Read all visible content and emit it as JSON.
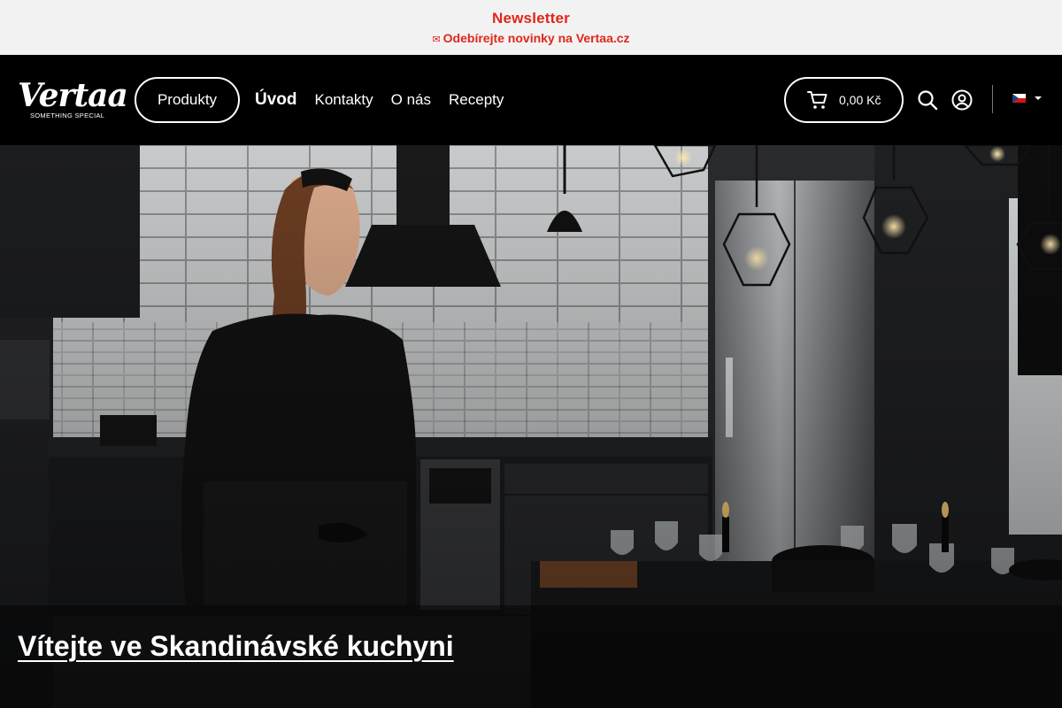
{
  "newsletter": {
    "title": "Newsletter",
    "icon": "envelope-icon",
    "subtitle": "Odebírejte novinky na Vertaa.cz"
  },
  "header": {
    "logo": {
      "wordmark": "Vertaa",
      "tagline": "SOMETHING SPECIAL"
    },
    "products_label": "Produkty",
    "nav": [
      {
        "label": "Úvod",
        "active": true
      },
      {
        "label": "Kontakty",
        "active": false
      },
      {
        "label": "O nás",
        "active": false
      },
      {
        "label": "Recepty",
        "active": false
      }
    ],
    "cart": {
      "amount": "0,00 Kč",
      "icon": "cart-icon"
    },
    "search_icon": "search-icon",
    "account_icon": "account-icon",
    "language": {
      "flag": "czech-flag-icon"
    }
  },
  "hero": {
    "title": "Vítejte ve Skandinávské kuchyni"
  },
  "colors": {
    "newsletter_bg": "#f2f2f2",
    "newsletter_text": "#e0261b",
    "header_bg": "#000000",
    "text_light": "#ffffff"
  }
}
